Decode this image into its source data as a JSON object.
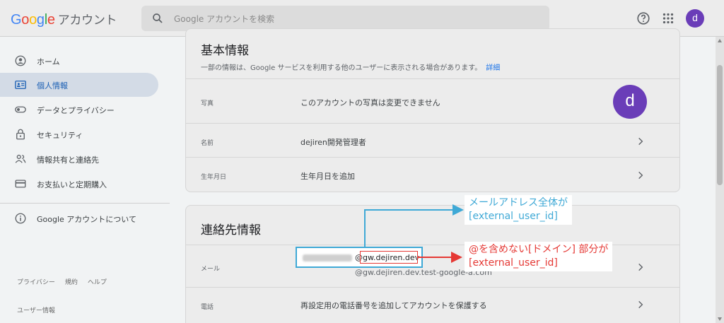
{
  "header": {
    "logo_letters": [
      "G",
      "o",
      "o",
      "g",
      "l",
      "e"
    ],
    "logo_suffix": "アカウント",
    "search_placeholder": "Google アカウントを検索",
    "avatar_letter": "d"
  },
  "sidebar": {
    "items": [
      {
        "label": "ホーム",
        "icon": "home-icon"
      },
      {
        "label": "個人情報",
        "icon": "id-card-icon"
      },
      {
        "label": "データとプライバシー",
        "icon": "toggle-icon"
      },
      {
        "label": "セキュリティ",
        "icon": "lock-icon"
      },
      {
        "label": "情報共有と連絡先",
        "icon": "people-icon"
      },
      {
        "label": "お支払いと定期購入",
        "icon": "card-icon"
      },
      {
        "label": "Google アカウントについて",
        "icon": "info-icon"
      }
    ],
    "footer_links": [
      "プライバシー",
      "規約",
      "ヘルプ"
    ],
    "user_info": "ユーザー情報"
  },
  "basic_info": {
    "title": "基本情報",
    "description": "一部の情報は、Google サービスを利用する他のユーザーに表示される場合があります。",
    "details_link": "詳細",
    "rows": [
      {
        "label": "写真",
        "value": "このアカウントの写真は変更できません"
      },
      {
        "label": "名前",
        "value": "dejiren開発管理者"
      },
      {
        "label": "生年月日",
        "value": "生年月日を追加"
      }
    ],
    "avatar_letter": "d"
  },
  "contact_info": {
    "title": "連絡先情報",
    "email_label": "メール",
    "email_domain": "@gw.dejiren.dev",
    "email_alias": "@gw.dejiren.dev.test-google-a.com",
    "phone_label": "電話",
    "phone_value": "再設定用の電話番号を追加してアカウントを保護する"
  },
  "annotations": {
    "blue_line1": "メールアドレス全体が",
    "blue_line2": "[external_user_id]",
    "red_line1": "@を含めない[ドメイン] 部分が",
    "red_line2": "[external_user_id]",
    "blue_color": "#3fa9d6",
    "red_color": "#e53935"
  }
}
